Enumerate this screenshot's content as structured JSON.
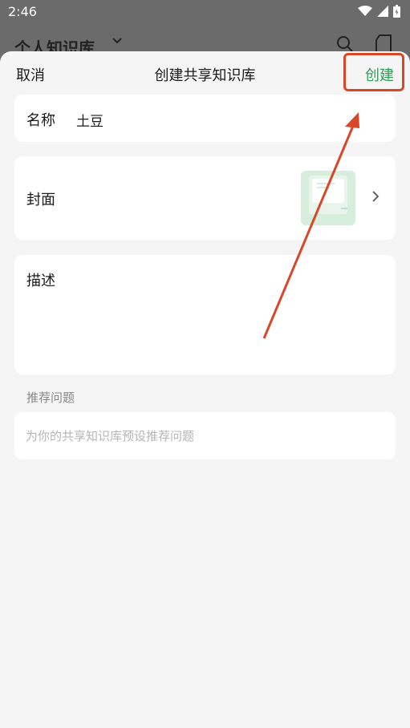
{
  "status_bar": {
    "time": "2:46"
  },
  "background": {
    "title": "个人知识库"
  },
  "sheet": {
    "cancel_label": "取消",
    "title": "创建共享知识库",
    "create_label": "创建"
  },
  "form": {
    "name": {
      "label": "名称",
      "value": "土豆"
    },
    "cover": {
      "label": "封面"
    },
    "description": {
      "label": "描述"
    },
    "questions": {
      "section_label": "推荐问题",
      "placeholder": "为你的共享知识库预设推荐问题"
    }
  },
  "colors": {
    "accent_green": "#2f9b54",
    "annotation_red": "#d9472b"
  }
}
